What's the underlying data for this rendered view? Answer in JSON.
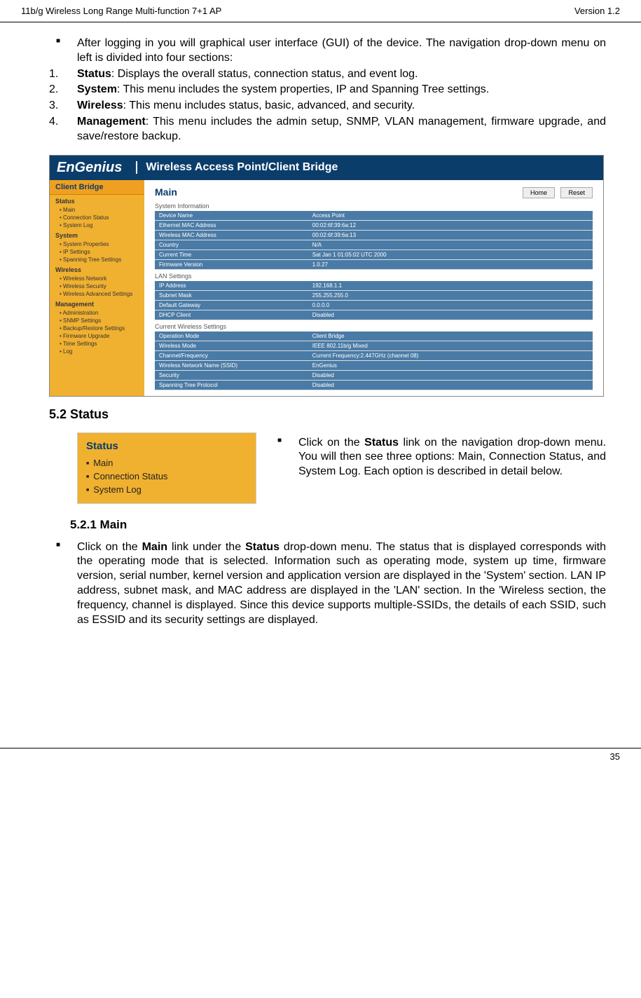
{
  "header": {
    "left": "11b/g Wireless Long Range Multi-function 7+1 AP",
    "right": "Version 1.2"
  },
  "intro": {
    "bullet": "After logging in you will graphical user interface (GUI) of the device. The navigation drop-down menu on left is divided into four sections:",
    "items": [
      {
        "num": "1.",
        "bold": "Status",
        "text": ": Displays the overall status, connection status, and event log."
      },
      {
        "num": "2.",
        "bold": "System",
        "text": ": This menu includes the system properties, IP and Spanning Tree settings."
      },
      {
        "num": "3.",
        "bold": "Wireless",
        "text": ": This menu includes status, basic, advanced, and security."
      },
      {
        "num": "4.",
        "bold": "Management",
        "text": ": This menu includes the admin setup, SNMP, VLAN management, firmware upgrade, and save/restore backup."
      }
    ]
  },
  "screenshot": {
    "logo": "EnGenius",
    "banner": "Wireless Access Point/Client Bridge",
    "sidebar_title": "Client Bridge",
    "sidebar": [
      {
        "section": "Status",
        "items": [
          "Main",
          "Connection Status",
          "System Log"
        ]
      },
      {
        "section": "System",
        "items": [
          "System Properties",
          "IP Settings",
          "Spanning Tree Settings"
        ]
      },
      {
        "section": "Wireless",
        "items": [
          "Wireless Network",
          "Wireless Security",
          "Wireless Advanced Settings"
        ]
      },
      {
        "section": "Management",
        "items": [
          "Administration",
          "SNMP Settings",
          "Backup/Restore Settings",
          "Firmware Upgrade",
          "Time Settings",
          "Log"
        ]
      }
    ],
    "main_title": "Main",
    "buttons": {
      "home": "Home",
      "reset": "Reset"
    },
    "sections": [
      {
        "label": "System Information",
        "rows": [
          [
            "Device Name",
            "Access Point"
          ],
          [
            "Ethernet MAC Address",
            "00:02:6f:39:6a:12"
          ],
          [
            "Wireless MAC Address",
            "00:02:6f:39:6a:13"
          ],
          [
            "Country",
            "N/A"
          ],
          [
            "Current Time",
            "Sat Jan 1 01:05:02 UTC 2000"
          ],
          [
            "Firmware Version",
            "1.0.27"
          ]
        ]
      },
      {
        "label": "LAN Settings",
        "rows": [
          [
            "IP Address",
            "192.168.1.1"
          ],
          [
            "Subnet Mask",
            "255.255.255.0"
          ],
          [
            "Default Gateway",
            "0.0.0.0"
          ],
          [
            "DHCP Client",
            "Disabled"
          ]
        ]
      },
      {
        "label": "Current Wireless Settings",
        "rows": [
          [
            "Operation Mode",
            "Client Bridge"
          ],
          [
            "Wireless Mode",
            "IEEE 802.11b/g Mixed"
          ],
          [
            "Channel/Frequency",
            "Current Frequency:2.447GHz (channel 08)"
          ],
          [
            "Wireless Network Name (SSID)",
            "EnGenius"
          ],
          [
            "Security",
            "Disabled"
          ],
          [
            "Spanning Tree Protocol",
            "Disabled"
          ]
        ]
      }
    ]
  },
  "section52": {
    "heading": "5.2 Status",
    "box_title": "Status",
    "box_items": [
      "Main",
      "Connection Status",
      "System Log"
    ],
    "text_pre": "Click on the ",
    "text_bold": "Status",
    "text_post": " link on the navigation drop-down menu. You will then see three options: Main, Connection Status, and System Log. Each option is described in detail below."
  },
  "section521": {
    "heading": "5.2.1   Main",
    "text_pre": "Click on the ",
    "text_bold1": "Main",
    "text_mid": " link under the ",
    "text_bold2": "Status",
    "text_post": " drop-down menu. The status that is displayed corresponds with the operating mode that is selected. Information such as operating mode, system up time, firmware version, serial number, kernel version and application version are displayed in the 'System' section. LAN IP address, subnet mask, and MAC address are displayed in the 'LAN' section. In the 'Wireless section, the frequency, channel is displayed. Since this device supports multiple-SSIDs, the details of each SSID, such as ESSID and its security settings are displayed."
  },
  "footer": {
    "page": "35"
  }
}
